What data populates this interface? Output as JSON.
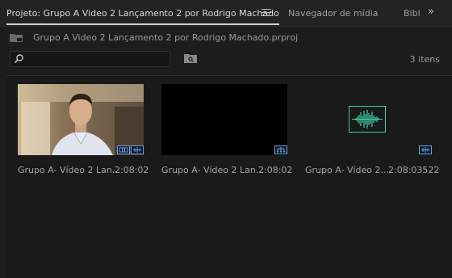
{
  "tabs": {
    "project": "Projeto: Grupo A Video 2 Lançamento 2 por Rodrigo Machado",
    "media_browser": "Navegador de mídia",
    "library": "Bibl"
  },
  "project": {
    "file_name": "Grupo A Video 2 Lançamento 2 por Rodrigo Machado.prproj",
    "item_count": "3 itens"
  },
  "search": {
    "value": "",
    "placeholder": ""
  },
  "items": [
    {
      "name": "Grupo A- Vídeo 2 Lan...",
      "duration": "2:08:02",
      "type": "video+audio"
    },
    {
      "name": "Grupo A- Vídeo 2 Lan...",
      "duration": "2:08:02",
      "type": "sequence"
    },
    {
      "name": "Grupo A- Vídeo 2...",
      "duration": "2:08:03522",
      "type": "audio"
    }
  ],
  "colors": {
    "accent_audio": "#3fcfa6",
    "badge_blue": "#6f9fe0"
  }
}
